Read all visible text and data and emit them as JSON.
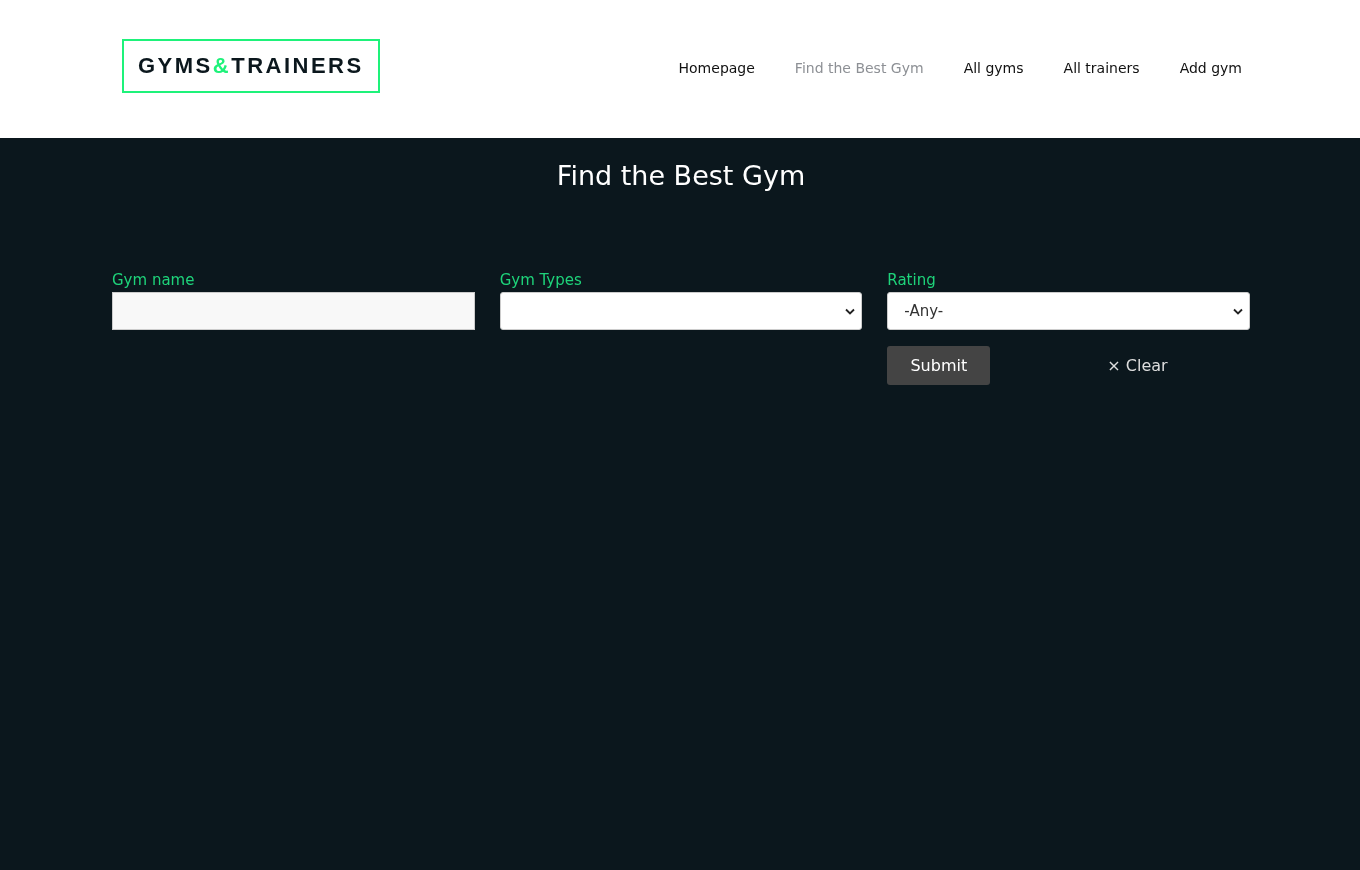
{
  "logo": {
    "left": "GYMS",
    "accent": "&",
    "right": "TRAINERS"
  },
  "nav": [
    {
      "label": "Homepage",
      "selected": false
    },
    {
      "label": "Find the Best Gym",
      "selected": true
    },
    {
      "label": "All gyms",
      "selected": false
    },
    {
      "label": "All trainers",
      "selected": false
    },
    {
      "label": "Add gym",
      "selected": false
    }
  ],
  "title": "Find the Best Gym",
  "fields": [
    {
      "kind": "text",
      "label": "Gym name"
    },
    {
      "kind": "select",
      "label": "Gym Types"
    },
    {
      "kind": "select",
      "label": "Rating",
      "value": "-Any-"
    }
  ],
  "submit": "Submit",
  "clear": "× Clear"
}
